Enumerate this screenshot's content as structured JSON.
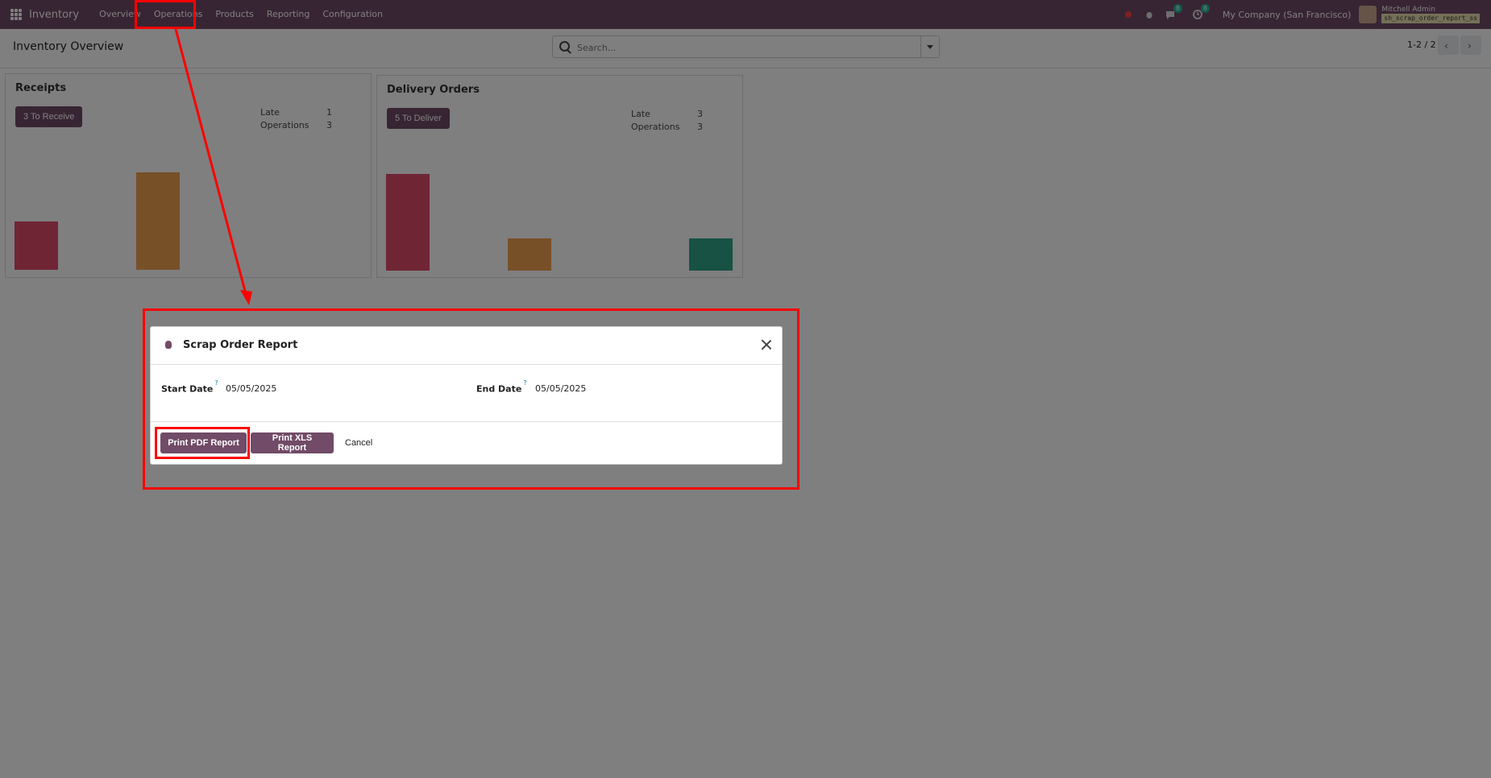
{
  "navbar": {
    "brand": "Inventory",
    "menu": [
      "Overview",
      "Operations",
      "Products",
      "Reporting",
      "Configuration"
    ],
    "company": "My Company (San Francisco)",
    "user_name": "Mitchell Admin",
    "user_db": "sh_scrap_order_report_ss",
    "messages_count": "8",
    "activities_count": "8"
  },
  "control": {
    "title": "Inventory Overview",
    "search_placeholder": "Search...",
    "pager": "1-2 / 2"
  },
  "receipts": {
    "title": "Receipts",
    "button": "3 To Receive",
    "late_label": "Late",
    "late_value": "1",
    "ops_label": "Operations",
    "ops_value": "3"
  },
  "deliveries": {
    "title": "Delivery Orders",
    "button": "5 To Deliver",
    "late_label": "Late",
    "late_value": "3",
    "ops_label": "Operations",
    "ops_value": "3"
  },
  "modal": {
    "title": "Scrap Order Report",
    "start_label": "Start Date",
    "start_value": "05/05/2025",
    "end_label": "End Date",
    "end_value": "05/05/2025",
    "help_mark": "?",
    "print_pdf": "Print PDF Report",
    "print_xls": "Print XLS Report",
    "cancel": "Cancel"
  },
  "colors": {
    "brand": "#714b67",
    "bar_red": "#e04a6a",
    "bar_orange": "#f0a050",
    "bar_teal": "#2ea48b",
    "annotation": "#ff0000"
  },
  "icons": [
    "apps-icon",
    "bug-icon",
    "chat-icon",
    "clock-icon",
    "search-icon",
    "close-icon",
    "chevron-left-icon",
    "chevron-right-icon"
  ]
}
